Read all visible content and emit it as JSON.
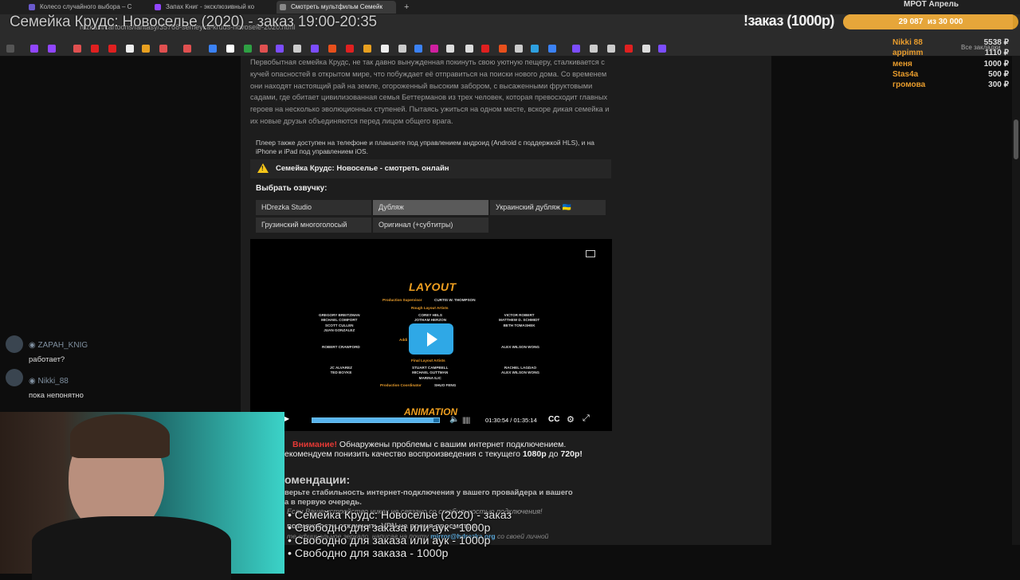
{
  "browser": {
    "tabs": [
      {
        "label": "Колесо случайного выбора – С",
        "color": "#6a5acd"
      },
      {
        "label": "Запах Книг - эксклюзивный ко",
        "color": "#9146ff"
      },
      {
        "label": "Смотреть мультфильм Семейк",
        "color": "#888888"
      }
    ],
    "new_tab": "+",
    "url": "rezka.fi/cartoons/fantasy/35768-semeyka-kruds-novosele-2020.html",
    "bookmarks_all": "Все закладки"
  },
  "stream_overlay": {
    "title": "Семейка Крудс: Новоселье (2020) - заказ 19:00-20:35",
    "order_label": "!заказ (1000р)",
    "goal_title": "МРОТ Апрель",
    "goal_current": "29 087",
    "goal_target": "из 30 000",
    "goal_fraction": 0.9696,
    "donors": [
      {
        "name": "Nikki 88",
        "amount": "5538 ₽"
      },
      {
        "name": "appimm",
        "amount": "1110 ₽"
      },
      {
        "name": "меня",
        "amount": "1000 ₽"
      },
      {
        "name": "Stas4a",
        "amount": "500 ₽"
      },
      {
        "name": "громова",
        "amount": "300 ₽"
      }
    ],
    "queue": [
      "• Семейка Крудс: Новоселье (2020) - заказ",
      "• Свободно для заказа или аук - 1000р",
      "• Свободно для заказа или аук - 1000р",
      "• Свободно для заказа - 1000р"
    ]
  },
  "page": {
    "description": "Первобытная семейка Крудс, не так давно вынужденная покинуть свою уютную пещеру, сталкивается с кучей опасностей в открытом мире, что побуждает её отправиться на поиски нового дома. Со временем они находят настоящий рай на земле, огороженный высоким забором, с высаженными фруктовыми садами, где обитает цивилизованная семья Беттерманов из трех человек, которая превосходит главных героев на несколько эволюционных ступеней. Пытаясь ужиться на одном месте, вскоре дикая семейка и их новые друзья объединяются перед лицом общего врага.",
    "player_note": "Плеер также доступен на телефоне и планшете под управлением андроид (Android с поддержкой HLS), и на iPhone и iPad под управлением iOS.",
    "watch_title": "Семейка Крудс: Новоселье - смотреть онлайн",
    "choose_voice": "Выбрать озвучку:",
    "voices": [
      {
        "label": "HDrezka Studio",
        "selected": false
      },
      {
        "label": "Дубляж",
        "selected": true
      },
      {
        "label": "Украинский дубляж 🇺🇦",
        "selected": false
      },
      {
        "label": "Грузинский многоголосый",
        "selected": false
      },
      {
        "label": "Оригинал (+субтитры)",
        "selected": false
      }
    ]
  },
  "player": {
    "time": "01:30:54 / 01:35:14",
    "progress_fraction": 0.9545,
    "cc": "CC",
    "credits": {
      "title": "LAYOUT",
      "production_supervisor_label": "Production Supervisor",
      "production_supervisor": "CURTIS W. THOMPSON",
      "rough_label": "Rough Layout Artists",
      "left_col": "GREGORY BREITZMAN\nMICHAEL COMFORT\nSCOTT CULLEN\nJUAN GONZALEZ",
      "center_col": "COREY HELS\nJOTHAM HERZON",
      "right_col": "VICTOR ROBERT\nMATTHEW D. SCHMIDT\nBETH TOMASHEK",
      "left_mid": "ROBERT CRAWFORD",
      "additional_label": "Addi",
      "right_mid": "ALEX WILSON WONG",
      "final_label": "Final Layout Artists",
      "final_center": "STUART CAMPBELL\nMICHAEL GUTTMAN\nMARINA ILIC",
      "final_left": "JC ALVAREZ\nTED BOYKE",
      "final_right": "RACHEL LAGDAO\nALEX WILSON WONG",
      "coordinator_label": "Production Coordinator",
      "coordinator": "SHUO FENG",
      "next_title": "ANIMATION"
    }
  },
  "warnings": {
    "attention": "Внимание!",
    "line1": " Обнаружены проблемы с вашим интернет подключением.",
    "line2_a": "екомендуем понизить качество воспроизведения с текущего ",
    "line2_b": "1080p",
    "line2_c": " до ",
    "line2_d": "720p",
    "line2_e": "!",
    "rec_title": "омендации:",
    "rec1": "верьте стабильность интернет-подключения у вашего провайдера и вашего\nа в первую очередь.",
    "italic1": "Если Ваше устройство никак не связано со стабильностью подключения!",
    "rec2": "возможности отключить VPN на время просмотра.",
    "italic2_a": "те официальное зеркало, написав на почту ",
    "italic2_link": "mirror@hdrezka.org",
    "italic2_b": " со своей личной"
  },
  "chat": [
    {
      "user": "ZAPAH_KNIG",
      "message": "работает?"
    },
    {
      "user": "Nikki_88",
      "message": "пока непонятно"
    }
  ],
  "colors": {
    "accent": "#e89c2c",
    "player_blue": "#2fa8e6",
    "warning_red": "#e53935"
  }
}
